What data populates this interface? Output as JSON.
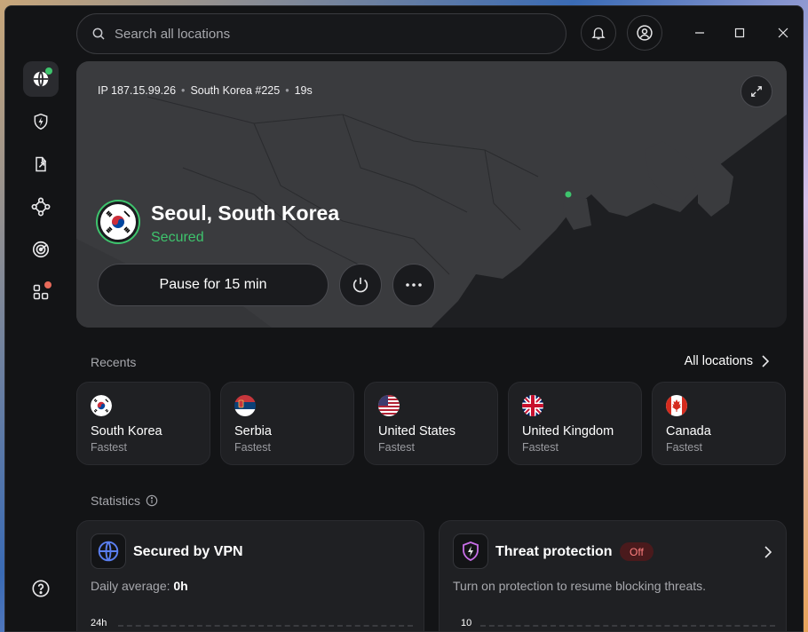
{
  "search": {
    "placeholder": "Search all locations"
  },
  "connection": {
    "ip": "IP 187.15.99.26",
    "server": "South Korea #225",
    "duration": "19s",
    "city": "Seoul, South Korea",
    "status": "Secured",
    "pause_label": "Pause for 15 min"
  },
  "recents": {
    "label": "Recents",
    "all_locations": "All locations",
    "items": [
      {
        "name": "South Korea",
        "sub": "Fastest",
        "flag": "kr"
      },
      {
        "name": "Serbia",
        "sub": "Fastest",
        "flag": "rs"
      },
      {
        "name": "United States",
        "sub": "Fastest",
        "flag": "us"
      },
      {
        "name": "United Kingdom",
        "sub": "Fastest",
        "flag": "gb"
      },
      {
        "name": "Canada",
        "sub": "Fastest",
        "flag": "ca"
      }
    ]
  },
  "statistics": {
    "label": "Statistics",
    "vpn_card": {
      "title": "Secured by VPN",
      "daily_label": "Daily average:",
      "daily_value": "0h",
      "axis_top": "24h"
    },
    "threat_card": {
      "title": "Threat protection",
      "badge": "Off",
      "description": "Turn on protection to resume blocking threats.",
      "axis_top": "10"
    }
  },
  "colors": {
    "accent_green": "#3ec46d",
    "notification_dot": "#e86a5a",
    "background": "#131416",
    "card": "#1f2023"
  },
  "icons": {
    "sidebar": [
      "globe-icon",
      "shield-bolt-icon",
      "file-export-icon",
      "mesh-network-icon",
      "target-icon",
      "apps-icon",
      "help-icon"
    ]
  }
}
